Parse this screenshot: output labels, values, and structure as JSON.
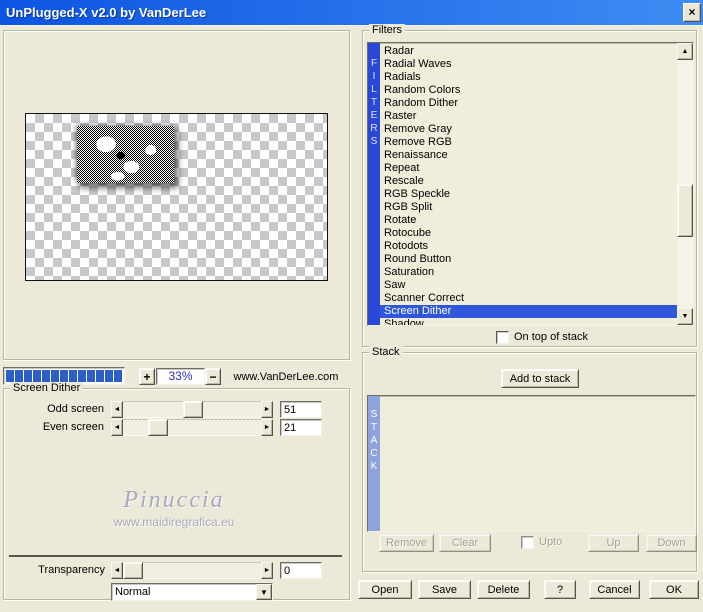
{
  "window": {
    "title": "UnPlugged-X v2.0 by VanDerLee",
    "close_label": "×"
  },
  "preview": {
    "progress_segments": 13,
    "zoom_in_label": "+",
    "zoom_level": "33%",
    "zoom_out_label": "−",
    "vendor_url": "www.VanDerLee.com"
  },
  "params": {
    "group_label": "Screen Dither",
    "sliders": [
      {
        "label": "Odd screen",
        "value": 51
      },
      {
        "label": "Even screen",
        "value": 21
      }
    ],
    "watermark": {
      "name": "Pinuccia",
      "url": "www.maidiregrafica.eu"
    },
    "transparency": {
      "label": "Transparency",
      "value": 0
    },
    "blend_mode": "Normal",
    "slider_arrows": {
      "left": "◄",
      "right": "►"
    },
    "combo_arrow": "▼"
  },
  "filters": {
    "group_label": "Filters",
    "side_label": "F\nI\nL\nT\nE\nR\nS",
    "items": [
      "Radar",
      "Radial Waves",
      "Radials",
      "Random Colors",
      "Random Dither",
      "Raster",
      "Remove Gray",
      "Remove RGB",
      "Renaissance",
      "Repeat",
      "Rescale",
      "RGB Speckle",
      "RGB Split",
      "Rotate",
      "Rotocube",
      "Rotodots",
      "Round Button",
      "Saturation",
      "Saw",
      "Scanner Correct",
      "Screen Dither",
      "Shadow"
    ],
    "selected": "Screen Dither",
    "on_top_label": "On top of stack",
    "scroll_up": "▲",
    "scroll_down": "▼"
  },
  "stack": {
    "group_label": "Stack",
    "add_button": "Add to stack",
    "side_label": "S\nT\nA\nC\nK",
    "remove_button": "Remove",
    "clear_button": "Clear",
    "upto_label": "Upto",
    "up_button": "Up",
    "down_button": "Down"
  },
  "footer": {
    "open": "Open",
    "save": "Save",
    "delete": "Delete",
    "help": "?",
    "cancel": "Cancel",
    "ok": "OK"
  },
  "colors": {
    "dialog_bg": "#ece9d8",
    "titlebar_left": "#0c55e1",
    "titlebar_right": "#3d8df3",
    "accent_blue": "#2948d8",
    "selection_blue": "#2e57da",
    "stack_bar": "#8ca3de",
    "progress_blue": "#2b5ec6",
    "percent_text": "#2a2ac0",
    "watermark": "#a9a9bf"
  }
}
